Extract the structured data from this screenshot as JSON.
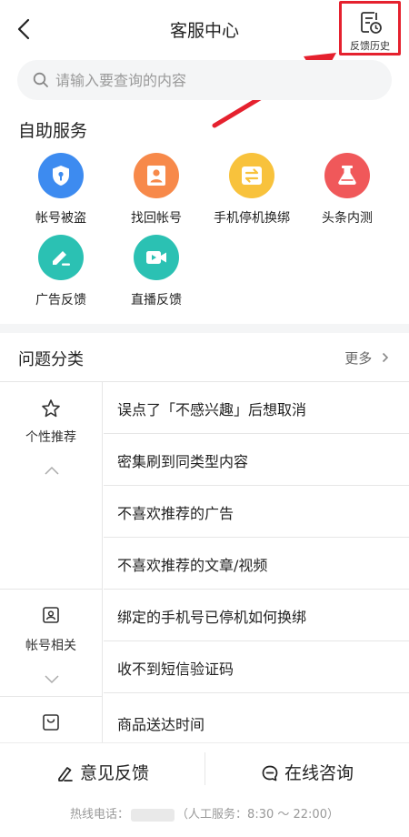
{
  "header": {
    "title": "客服中心",
    "history_label": "反馈历史"
  },
  "search": {
    "placeholder": "请输入要查询的内容"
  },
  "self_service": {
    "title": "自助服务",
    "items": [
      {
        "label": "帐号被盗",
        "icon": "shield-icon",
        "color": "#3d8bf0"
      },
      {
        "label": "找回帐号",
        "icon": "person-icon",
        "color": "#f7894a"
      },
      {
        "label": "手机停机换绑",
        "icon": "swap-icon",
        "color": "#f8c23c"
      },
      {
        "label": "头条内测",
        "icon": "flask-icon",
        "color": "#f0585a"
      },
      {
        "label": "广告反馈",
        "icon": "edit-icon",
        "color": "#2bc1b3"
      },
      {
        "label": "直播反馈",
        "icon": "video-icon",
        "color": "#2bc1b3"
      }
    ]
  },
  "categories": {
    "title": "问题分类",
    "more_label": "更多",
    "groups": [
      {
        "name": "个性推荐",
        "icon": "star-icon",
        "expanded": true,
        "questions": [
          "误点了「不感兴趣」后想取消",
          "密集刷到同类型内容",
          "不喜欢推荐的广告",
          "不喜欢推荐的文章/视频"
        ]
      },
      {
        "name": "帐号相关",
        "icon": "id-card-icon",
        "expanded": false,
        "questions": [
          "绑定的手机号已停机如何换绑",
          "收不到短信验证码"
        ]
      },
      {
        "name": "",
        "icon": "shopping-bag-icon",
        "expanded": false,
        "questions": [
          "商品送达时间"
        ]
      }
    ]
  },
  "bottom": {
    "feedback_label": "意见反馈",
    "consult_label": "在线咨询",
    "hotline_prefix": "热线电话：",
    "hotline_service": "（人工服务：8:30 ～ 22:00）"
  },
  "colors": {
    "highlight": "#e5212e",
    "divider": "#f4f5f6"
  }
}
